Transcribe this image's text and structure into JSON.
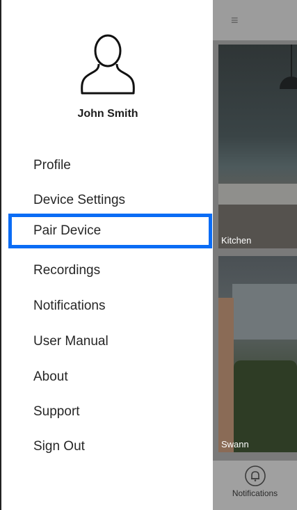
{
  "user": {
    "name": "John Smith"
  },
  "menu": [
    {
      "label": "Profile"
    },
    {
      "label": "Device Settings"
    },
    {
      "label": "Pair Device",
      "selected": true
    },
    {
      "label": "Recordings"
    },
    {
      "label": "Notifications"
    },
    {
      "label": "User Manual"
    },
    {
      "label": "About"
    },
    {
      "label": "Support"
    },
    {
      "label": "Sign Out"
    }
  ],
  "cameras": [
    {
      "label": "Kitchen"
    },
    {
      "label": "Swann"
    }
  ],
  "bottom_nav": {
    "notifications_label": "Notifications"
  },
  "icons": {
    "menu": "hamburger-icon",
    "avatar": "user-avatar-icon",
    "bell": "bell-icon"
  },
  "colors": {
    "selection": "#0a6cf5"
  }
}
